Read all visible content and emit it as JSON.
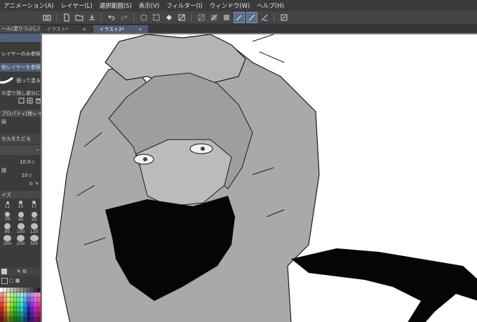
{
  "menu": [
    "アニメーション(A)",
    "レイヤー(L)",
    "選択範囲(S)",
    "表示(V)",
    "フィルター(I)",
    "ウィンドウ(W)",
    "ヘルプ(H)"
  ],
  "tabs": [
    {
      "label": "イラスト*",
      "active": false
    },
    {
      "label": "イラスト2*",
      "active": true
    }
  ],
  "tab_close_glyph": "×",
  "tool_property": {
    "panel_title": "ール(塗りつぶし)",
    "mode_ref_layer": "レイヤーのみ参照",
    "mode_ref_other": "他レイヤーを参照",
    "fill_enclosed": "囲って塗る",
    "fill_unpainted": "の塗り残し部分に塗る",
    "subtool_detail": "ブロパティ[他レイヤーを",
    "ref_label": "照",
    "follow_pixels": "セルをたどる",
    "value1": "10.0",
    "label_gap": "縫",
    "value2": "10"
  },
  "brush_size": {
    "title": "イズ",
    "sizes": [
      "12",
      "15",
      "17",
      "30",
      "40",
      "50",
      "80",
      "100",
      "120",
      "200",
      "250",
      "300"
    ]
  },
  "colors": {
    "accent": "#4f5f7c",
    "panel_bg": "#3b3b3b",
    "menubar_bg": "#3a3a3a",
    "canvas_bg": "#ffffff"
  },
  "icons": [
    "camera-icon",
    "new-document-icon",
    "open-file-icon",
    "save-icon",
    "undo-icon",
    "redo-icon",
    "clear-icon",
    "deselect-icon",
    "fill-icon",
    "transform-icon",
    "pen-tool-icon",
    "brush-tool-icon",
    "ruler-icon",
    "sticky-note-icon"
  ]
}
